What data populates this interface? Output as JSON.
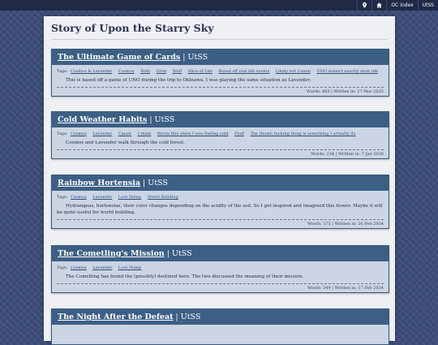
{
  "topbar": {
    "location_icon": "map-pin-icon",
    "home_icon": "home-icon",
    "oc_index": "OC index",
    "utss": "UtSS"
  },
  "page": {
    "title": "Story of Upon the Starry Sky"
  },
  "tags_label": "Tags:",
  "stories": [
    {
      "title": "The Ultimate Game of Cards",
      "fandom": "UtSS",
      "tags": [
        "Cosmos & Lavender",
        "Cosmos",
        "Both",
        "Gren",
        "Wolf",
        "Slice of Life",
        "Based off real life events",
        "Likely not Canon",
        "UNO doesn't exactly exist tdk"
      ],
      "summary": "This is based off a game of UNO during the trip to Okinawa. I was playing the same situation as Lavender.",
      "meta": "Words: 463 | Written in: 27 Mar 2025"
    },
    {
      "title": "Cold Weather Habits",
      "fandom": "UtSS",
      "tags": [
        "Cosmos",
        "Lavender",
        "Canon",
        "I think",
        "Wrote this when I was feeling cold",
        "Fluff",
        "The thumb tucking thing is something I actually do"
      ],
      "summary": "Cosmos and Lavender walk through the cold forest.",
      "meta": "Words: 234 | Written in: 7 Jan 2026"
    },
    {
      "title": "Rainbow Hortensia",
      "fandom": "UtSS",
      "tags": [
        "Cosmos",
        "Lavender",
        "Lore Dump",
        "World Building"
      ],
      "summary": "Hydrangeas, hortensias, their color changes depending on the acidity of the soil. So I got inspired and imagined this flower. Maybe it will be quite useful for world building.",
      "meta": "Words: 375 | Written in: 26 Feb 2024"
    },
    {
      "title": "The Cometling's Mission",
      "fandom": "UtSS",
      "tags": [
        "Cosmos",
        "Lavender",
        "Lore Dump"
      ],
      "summary": "The Cometling has found the (possibly) destined hero. The two discussed the meaning of their mission.",
      "meta": "Words: 349 | Written in: 17 Feb 2024"
    },
    {
      "title": "The Night After the Defeat",
      "fandom": "UtSS"
    }
  ]
}
